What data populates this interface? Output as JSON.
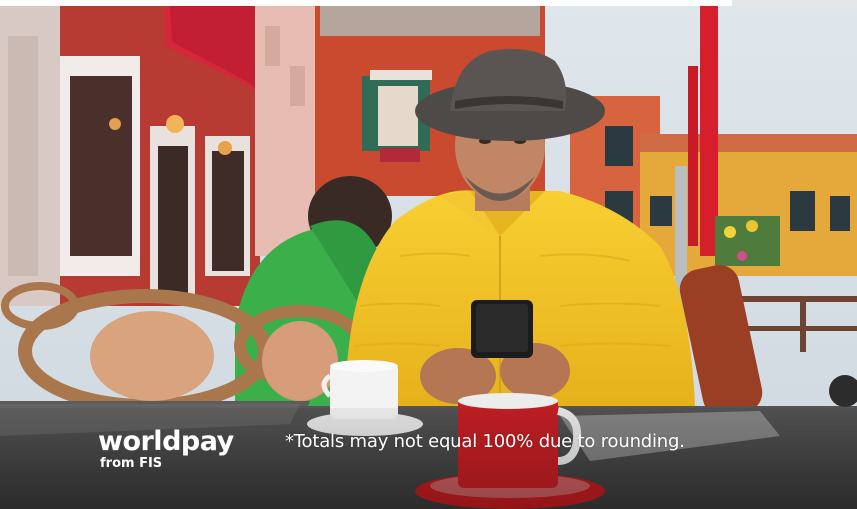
{
  "brand": {
    "name": "worldpay",
    "sub": "from FIS"
  },
  "footnote": "*Totals may not equal 100% due to rounding.",
  "image": {
    "subject": "man-in-yellow-jacket-using-phone-at-outdoor-cafe"
  },
  "colors": {
    "jacket": "#f5c526",
    "awning": "#d6263a",
    "building": "#c94a2f",
    "table": "#4a4a4a",
    "cup": "#c51f24"
  }
}
